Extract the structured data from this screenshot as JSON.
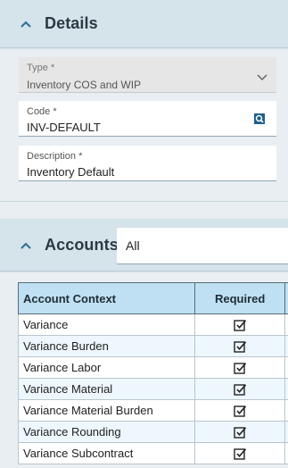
{
  "details": {
    "title": "Details",
    "type_field": {
      "label": "Type *",
      "value": "Inventory COS and WIP"
    },
    "code_field": {
      "label": "Code *",
      "value": "INV-DEFAULT"
    },
    "description_field": {
      "label": "Description *",
      "value": "Inventory Default"
    }
  },
  "accounts": {
    "title": "Accounts",
    "filter_value": "All",
    "columns": [
      "Account Context",
      "Required"
    ],
    "rows": [
      {
        "context": "Variance",
        "required": true
      },
      {
        "context": "Variance Burden",
        "required": true
      },
      {
        "context": "Variance Labor",
        "required": true
      },
      {
        "context": "Variance Material",
        "required": true
      },
      {
        "context": "Variance Material Burden",
        "required": true
      },
      {
        "context": "Variance Rounding",
        "required": true
      },
      {
        "context": "Variance Subcontract",
        "required": true
      }
    ]
  },
  "colors": {
    "header_bg": "#d5e3ea",
    "table_header_bg": "#bfe0f3",
    "accent": "#1f5f8b"
  }
}
